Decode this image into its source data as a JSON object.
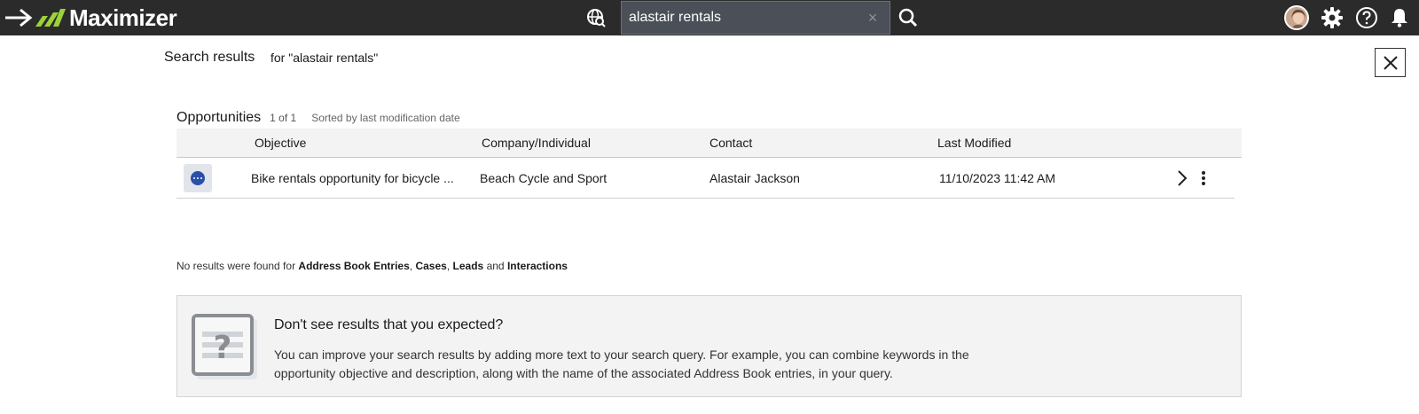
{
  "app": {
    "name": "Maximizer"
  },
  "search": {
    "value": "alastair rentals",
    "clear_glyph": "×"
  },
  "page": {
    "title": "Search results",
    "query_text": "for \"alastair rentals\""
  },
  "opportunities": {
    "title": "Opportunities",
    "count": "1 of 1",
    "sort_text": "Sorted by last modification date",
    "columns": [
      "Objective",
      "Company/Individual",
      "Contact",
      "Last Modified"
    ],
    "rows": [
      {
        "objective": "Bike rentals opportunity for bicycle ...",
        "company": "Beach Cycle and Sport",
        "contact": "Alastair Jackson",
        "last_modified": "11/10/2023 11:42 AM"
      }
    ]
  },
  "no_results": {
    "prefix": "No results were found for",
    "item1": "Address Book Entries",
    "sep1": ",",
    "item2": "Cases",
    "sep2": ",",
    "item3": "Leads",
    "conj": "and",
    "item4": "Interactions"
  },
  "hint": {
    "title": "Don't see results that you expected?",
    "text": "You can improve your search results by adding more text to your search query. For example, you can combine keywords in the opportunity objective and description, along with the name of the associated Address Book entries, in your query."
  },
  "colors": {
    "topbar": "#2b2b2b",
    "logo_accent": "#9bd13a",
    "badge_dot": "#2a4fa8"
  },
  "icons": [
    "arrow-right-icon",
    "maximizer-logo-icon",
    "globe-search-icon",
    "search-icon",
    "avatar",
    "gear-icon",
    "help-icon",
    "bell-icon",
    "close-icon",
    "chevron-right-icon",
    "more-vertical-icon",
    "question-document-icon"
  ]
}
